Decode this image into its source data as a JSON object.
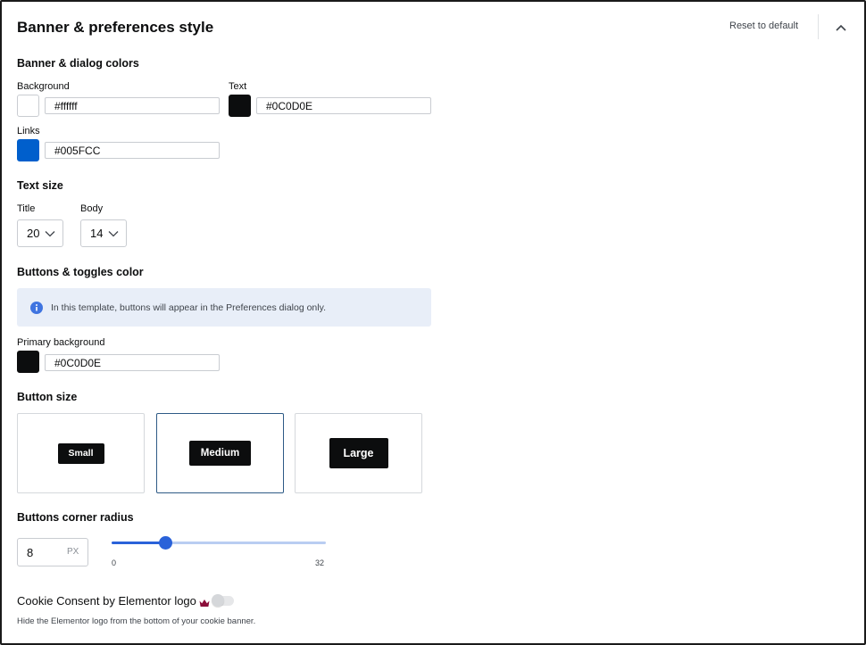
{
  "header": {
    "title": "Banner & preferences style",
    "reset_label": "Reset to default",
    "collapse_icon": "chevron-up-icon"
  },
  "colors_section": {
    "heading": "Banner & dialog colors",
    "background": {
      "label": "Background",
      "value": "#ffffff",
      "color": "#ffffff"
    },
    "text": {
      "label": "Text",
      "value": "#0C0D0E",
      "color": "#0c0d0e"
    },
    "links": {
      "label": "Links",
      "value": "#005FCC",
      "color": "#005fcc"
    }
  },
  "text_size": {
    "heading": "Text size",
    "title": {
      "label": "Title",
      "value": "20"
    },
    "body": {
      "label": "Body",
      "value": "14"
    }
  },
  "buttons_color": {
    "heading": "Buttons & toggles color",
    "info_icon": "info-icon",
    "info_text": "In this template, buttons will appear in the Preferences dialog only.",
    "info_color": "#3f74e0",
    "primary": {
      "label": "Primary background",
      "value": "#0C0D0E",
      "color": "#0c0d0e"
    }
  },
  "button_size": {
    "heading": "Button size",
    "options": [
      {
        "label": "Small",
        "selected": false
      },
      {
        "label": "Medium",
        "selected": true
      },
      {
        "label": "Large",
        "selected": false
      }
    ]
  },
  "corner_radius": {
    "heading": "Buttons corner radius",
    "value": "8",
    "unit": "PX",
    "min": "0",
    "max": "32",
    "slider_value": 8,
    "accent": "#2a62d9"
  },
  "logo": {
    "label": "Cookie Consent by Elementor logo",
    "crown_icon": "crown-icon",
    "crown_color": "#8b0e3a",
    "toggle_on": false,
    "hint": "Hide the Elementor logo from the bottom of your cookie banner."
  }
}
